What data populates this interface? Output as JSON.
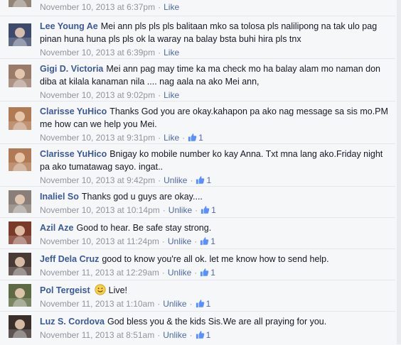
{
  "comments": [
    {
      "id": "c0",
      "name": "",
      "text": "",
      "date": "November 10, 2013 at 6:37pm",
      "action": "Like",
      "likes": "",
      "avatar_color": "#7a6a5a"
    },
    {
      "id": "c1",
      "name": "Lee Young Ae",
      "text": "Mei ann pls pls pls balitaan mko sa tolosa pls nalilipong na tak ulo pag pinan huna huna pls pls ok la waray na balay bsta buhi hira pls tnx",
      "date": "November 10, 2013 at 6:39pm",
      "action": "Like",
      "likes": "",
      "avatar_color": "#3d4a6b"
    },
    {
      "id": "c2",
      "name": "Gigi D. Victoria",
      "text": "Mei ann pag may time ka ma check mo ha balay alam mo naman don diba at kilala kanaman nila .... nag aala na ako Mei ann,",
      "date": "November 10, 2013 at 9:02pm",
      "action": "Like",
      "likes": "",
      "avatar_color": "#9a7b6a"
    },
    {
      "id": "c3",
      "name": "Clarisse YuHico",
      "text": "Thanks God you are okay.kahapon pa ako nag message sa sis mo.PM me how can we help you Mei.",
      "date": "November 10, 2013 at 9:31pm",
      "action": "Like",
      "likes": "1",
      "avatar_color": "#b07a54"
    },
    {
      "id": "c4",
      "name": "Clarisse YuHico",
      "text": "Bnigay ko mobile number ko kay Anna. Txt mna lang ako.Friday night pa ako tumatawag sayo. ingat..",
      "date": "November 10, 2013 at 9:42pm",
      "action": "Unlike",
      "likes": "1",
      "avatar_color": "#b07a54"
    },
    {
      "id": "c5",
      "name": "Inaliel So",
      "text": "Thanks god u guys are okay....",
      "date": "November 10, 2013 at 10:14pm",
      "action": "Unlike",
      "likes": "1",
      "avatar_color": "#8a7f78"
    },
    {
      "id": "c6",
      "name": "Azil Aze",
      "text": "Good to hear. Be safe stay strong.",
      "date": "November 10, 2013 at 11:24pm",
      "action": "Unlike",
      "likes": "1",
      "avatar_color": "#7a3a2a"
    },
    {
      "id": "c7",
      "name": "Jeff Dela Cruz",
      "text": "good to know you're all ok. let me know how to send help.",
      "date": "November 11, 2013 at 12:29am",
      "action": "Unlike",
      "likes": "1",
      "avatar_color": "#4a3a36"
    },
    {
      "id": "c8",
      "name": "Pol Tergeist",
      "text": "Live!",
      "date": "November 11, 2013 at 1:10am",
      "action": "Unlike",
      "likes": "1",
      "avatar_color": "#5e6a44",
      "has_emoji": true
    },
    {
      "id": "c9",
      "name": "Luz S. Cordova",
      "text": "God bless you & the kids Sis.We are all praying for you.",
      "date": "November 11, 2013 at 8:51am",
      "action": "Unlike",
      "likes": "1",
      "avatar_color": "#3a2e2a"
    }
  ],
  "colors": {
    "link": "#3b5998",
    "meta": "#90949c",
    "action": "#4e69a2",
    "background": "#f6f7f9"
  },
  "icons": {
    "like": "thumbs-up-icon",
    "emoji": "smiley-icon"
  }
}
